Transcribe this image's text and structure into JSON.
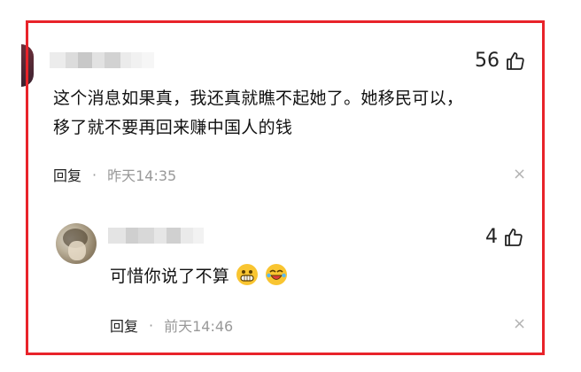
{
  "comments": [
    {
      "likes": "56",
      "text_line1": "这个消息如果真，我还真就瞧不起她了。她移民可以，",
      "text_line2": "移了就不要再回来赚中国人的钱",
      "reply_label": "回复",
      "separator": "·",
      "time": "昨天14:35",
      "close": "×"
    },
    {
      "likes": "4",
      "text": "可惜你说了不算",
      "emojis": [
        "grinning-face-emoji",
        "laughing-crying-face-emoji"
      ],
      "reply_label": "回复",
      "separator": "·",
      "time": "前天14:46",
      "close": "×"
    }
  ],
  "colors": {
    "frame": "#e8232a",
    "text": "#111111",
    "meta": "#999999",
    "emoji": "#f9c531"
  }
}
